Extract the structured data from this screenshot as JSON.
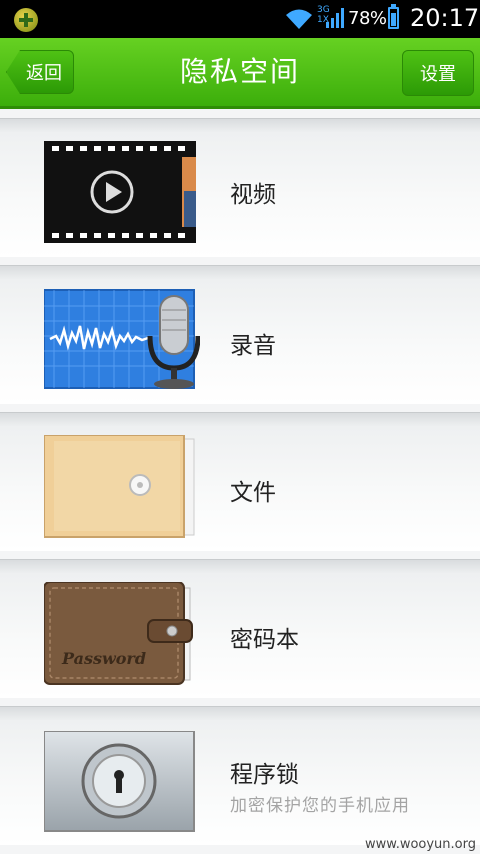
{
  "status_bar": {
    "network": "3G\n1X",
    "battery_percent": "78%",
    "time": "20:17",
    "icons": [
      "app-icon",
      "wifi-icon",
      "signal-icon",
      "battery-icon"
    ]
  },
  "header": {
    "back_label": "返回",
    "title": "隐私空间",
    "settings_label": "设置"
  },
  "items": [
    {
      "label": "视频",
      "icon": "video-film-icon",
      "subtitle": ""
    },
    {
      "label": "录音",
      "icon": "microphone-icon",
      "subtitle": ""
    },
    {
      "label": "文件",
      "icon": "envelope-icon",
      "subtitle": ""
    },
    {
      "label": "密码本",
      "icon": "wallet-icon",
      "subtitle": "",
      "icon_text": "Password"
    },
    {
      "label": "程序锁",
      "icon": "lock-safe-icon",
      "subtitle": "加密保护您的手机应用"
    }
  ],
  "watermark": "www.wooyun.org",
  "colors": {
    "header_green": "#4cbd14",
    "status_blue": "#3fa9ff"
  }
}
